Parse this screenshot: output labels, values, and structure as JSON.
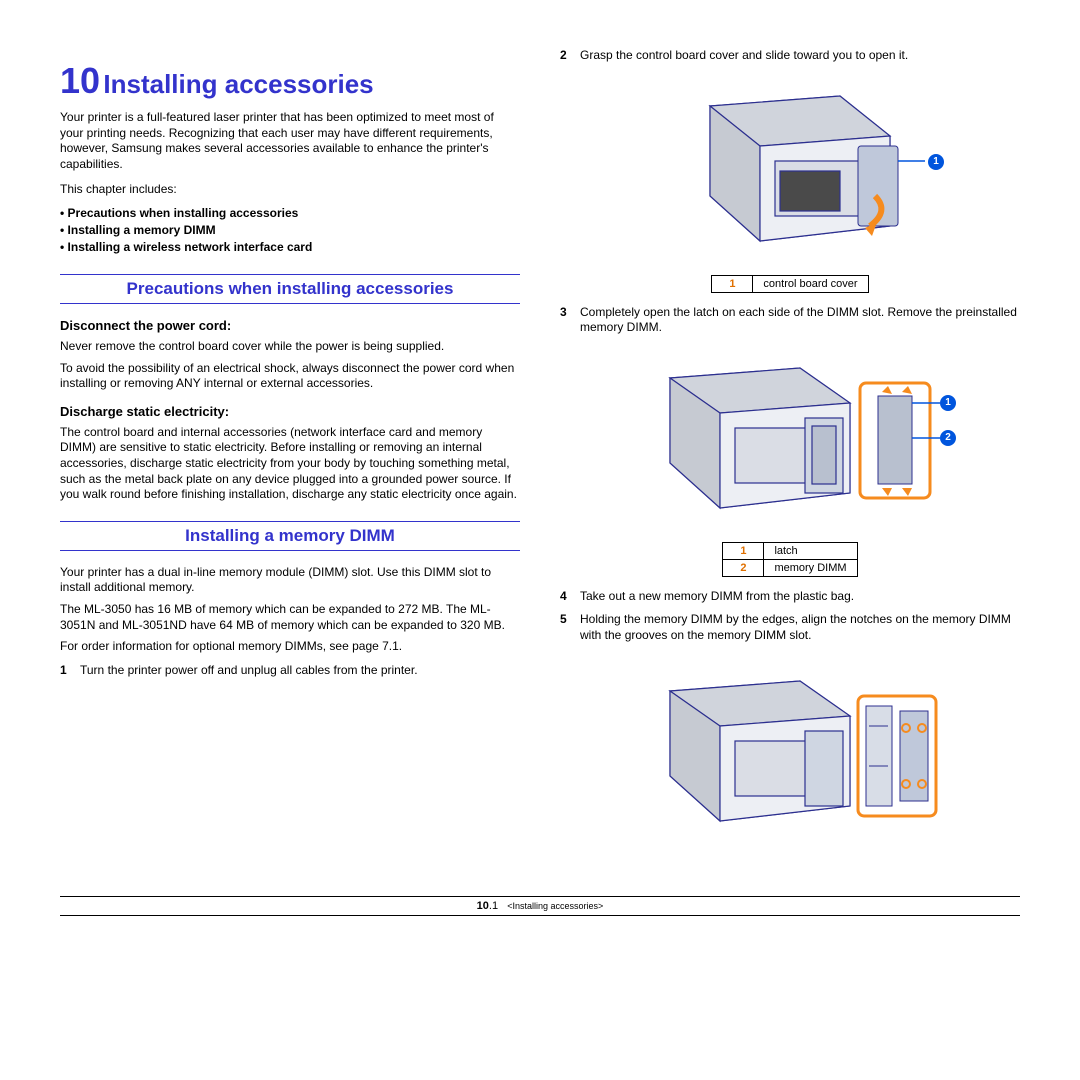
{
  "chapter": {
    "number": "10",
    "title": "Installing accessories"
  },
  "intro": "Your printer is a full-featured laser printer that has been optimized to meet most of your printing needs. Recognizing that each user may have different requirements, however, Samsung makes several accessories available to enhance the printer's capabilities.",
  "includes_label": "This chapter includes:",
  "bullets": [
    "Precautions when installing accessories",
    "Installing a memory DIMM",
    "Installing a wireless network interface card"
  ],
  "section1": {
    "heading": "Precautions when installing accessories",
    "sub1": "Disconnect the power cord:",
    "p1": "Never remove the control board cover while the power is being supplied.",
    "p2": "To avoid the possibility of an electrical shock, always disconnect the power cord when installing or removing ANY internal or external accessories.",
    "sub2": "Discharge static electricity:",
    "p3": "The control board and internal accessories (network interface card and memory DIMM) are sensitive to static electricity. Before installing or removing an internal accessories, discharge static electricity from your body by touching something metal, such as the metal back plate on any device plugged into a grounded power source. If you walk round before finishing installation, discharge any static electricity once again."
  },
  "section2": {
    "heading": "Installing a memory DIMM",
    "p1": "Your printer has a dual in-line memory module (DIMM) slot. Use this DIMM slot to install additional memory.",
    "p2": "The ML-3050 has 16 MB of memory which can be expanded to 272 MB. The ML-3051N and ML-3051ND have 64 MB of memory which can be expanded to 320 MB.",
    "p3": "For order information for optional memory DIMMs, see page 7.1.",
    "step1": "Turn the printer power off and unplug all cables from the printer."
  },
  "right": {
    "step2": "Grasp the control board cover and slide toward you to open it.",
    "legend2": {
      "1": "control board cover"
    },
    "step3": "Completely open the latch on each side of the DIMM slot. Remove the preinstalled memory DIMM.",
    "legend3": {
      "1": "latch",
      "2": "memory DIMM"
    },
    "step4": "Take out a new memory DIMM from the plastic bag.",
    "step5": "Holding the memory DIMM by the edges, align the notches on the memory DIMM with the grooves on the memory DIMM slot."
  },
  "footer": {
    "page_chapter": "10",
    "page_num": ".1",
    "label": "<Installing accessories>"
  }
}
